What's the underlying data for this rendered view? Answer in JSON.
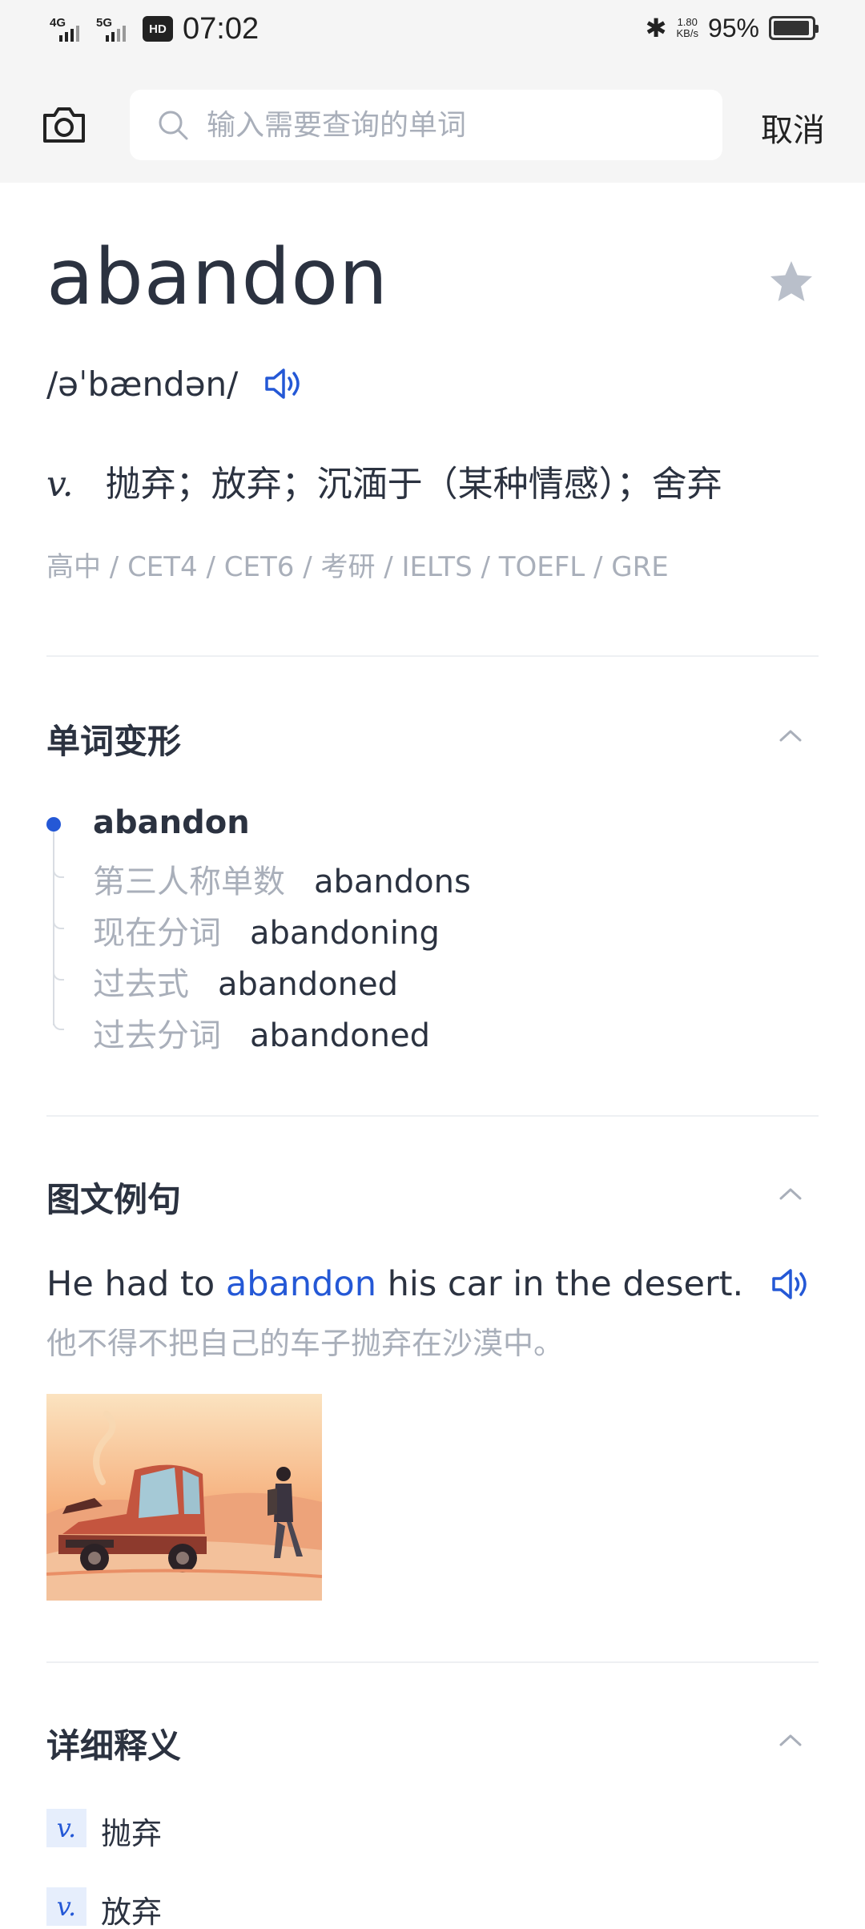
{
  "status_bar": {
    "sim1_label": "4G",
    "sim2_label": "5G",
    "hd_label": "HD",
    "time": "07:02",
    "net_speed_value": "1.80",
    "net_speed_unit": "KB/s",
    "battery_percent": "95%",
    "battery_level": 0.95
  },
  "search": {
    "placeholder": "输入需要查询的单词",
    "value": "",
    "cancel_label": "取消"
  },
  "entry": {
    "word": "abandon",
    "phonetic": "/əˈbændən/",
    "pos": "v.",
    "definition": "抛弃；放弃；沉湎于（某种情感）；舍弃",
    "levels": "高中 / CET4 / CET6 / 考研 / IELTS / TOEFL / GRE"
  },
  "inflections": {
    "title": "单词变形",
    "base": "abandon",
    "forms": [
      {
        "label": "第三人称单数",
        "value": "abandons"
      },
      {
        "label": "现在分词",
        "value": "abandoning"
      },
      {
        "label": "过去式",
        "value": "abandoned"
      },
      {
        "label": "过去分词",
        "value": "abandoned"
      }
    ]
  },
  "example": {
    "title": "图文例句",
    "en_before": "He had to ",
    "en_highlight": "abandon",
    "en_after": " his car in the desert.",
    "zh": "他不得不把自己的车子抛弃在沙漠中。"
  },
  "detailed": {
    "title": "详细释义",
    "items": [
      {
        "pos": "v.",
        "meaning": "抛弃"
      },
      {
        "pos": "v.",
        "meaning": "放弃"
      }
    ]
  },
  "colors": {
    "accent": "#2458d6",
    "text_primary": "#2b3240",
    "text_secondary": "#a9afba",
    "header_bg": "#f5f5f5"
  }
}
